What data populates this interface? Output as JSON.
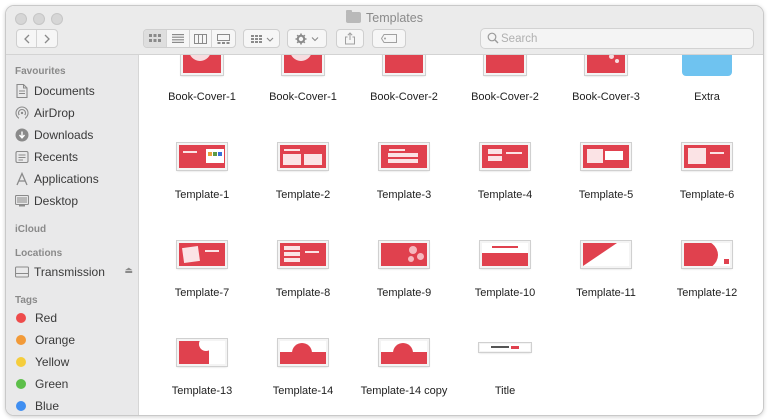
{
  "window": {
    "title": "Templates"
  },
  "toolbar": {
    "nav_back_icon": "chevron-left",
    "nav_forward_icon": "chevron-right",
    "view_modes": [
      "icon-view",
      "list-view",
      "column-view",
      "gallery-view"
    ],
    "group_icon": "grid-dropdown",
    "action_icon": "gear-dropdown",
    "share_icon": "share",
    "tag_icon": "tag"
  },
  "search": {
    "placeholder": "Search"
  },
  "sidebar": {
    "favourites_header": "Favourites",
    "favourites": [
      {
        "label": "Documents",
        "icon": "document-icon"
      },
      {
        "label": "AirDrop",
        "icon": "airdrop-icon"
      },
      {
        "label": "Downloads",
        "icon": "download-icon"
      },
      {
        "label": "Recents",
        "icon": "clock-icon"
      },
      {
        "label": "Applications",
        "icon": "applications-icon"
      },
      {
        "label": "Desktop",
        "icon": "desktop-icon"
      }
    ],
    "icloud_header": "iCloud",
    "locations_header": "Locations",
    "locations": [
      {
        "label": "Transmission",
        "icon": "drive-icon"
      }
    ],
    "tags_header": "Tags",
    "tags": [
      {
        "label": "Red",
        "color": "#ee4b4b"
      },
      {
        "label": "Orange",
        "color": "#f29a38"
      },
      {
        "label": "Yellow",
        "color": "#f5cd3c"
      },
      {
        "label": "Green",
        "color": "#5dbf4a"
      },
      {
        "label": "Blue",
        "color": "#3f8ef1"
      }
    ]
  },
  "files": [
    {
      "label": "Book-Cover-1"
    },
    {
      "label": "Book-Cover-1"
    },
    {
      "label": "Book-Cover-2"
    },
    {
      "label": "Book-Cover-2"
    },
    {
      "label": "Book-Cover-3"
    },
    {
      "label": "Extra"
    },
    {
      "label": "Template-1"
    },
    {
      "label": "Template-2"
    },
    {
      "label": "Template-3"
    },
    {
      "label": "Template-4"
    },
    {
      "label": "Template-5"
    },
    {
      "label": "Template-6"
    },
    {
      "label": "Template-7"
    },
    {
      "label": "Template-8"
    },
    {
      "label": "Template-9"
    },
    {
      "label": "Template-10"
    },
    {
      "label": "Template-11"
    },
    {
      "label": "Template-12"
    },
    {
      "label": "Template-13"
    },
    {
      "label": "Template-14"
    },
    {
      "label": "Template-14 copy"
    },
    {
      "label": "Title"
    }
  ],
  "colors": {
    "template_red": "#e0414e",
    "folder_blue": "#6fc3f0"
  }
}
